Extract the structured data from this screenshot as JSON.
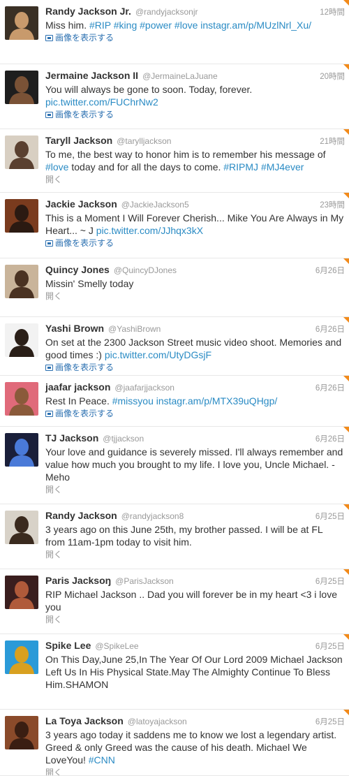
{
  "colors": {
    "link": "#2a8bc4",
    "corner": "#f28a1a",
    "muted": "#999999"
  },
  "tweets": [
    {
      "name": "Randy Jackson Jr.",
      "handle": "@randyjacksonjr",
      "time": "12時間",
      "action": "画像を表示する",
      "action_type": "media",
      "segments": [
        {
          "t": "Miss him. ",
          "link": false
        },
        {
          "t": "#RIP #king #power #love instagr.am/p/MUzlNrl_Xu/",
          "link": true
        }
      ],
      "avatar": {
        "bg": "#3a3025",
        "fg": "#c89a6c"
      }
    },
    {
      "name": "Jermaine Jackson II",
      "handle": "@JermaineLaJuane",
      "time": "20時間",
      "action": "画像を表示する",
      "action_type": "media",
      "segments": [
        {
          "t": "You will always be gone to soon. Today, forever. ",
          "link": false
        },
        {
          "t": "pic.twitter.com/FUChrNw2",
          "link": true
        }
      ],
      "avatar": {
        "bg": "#1e1e1e",
        "fg": "#7a5236"
      }
    },
    {
      "name": "Taryll Jackson",
      "handle": "@tarylljackson",
      "time": "21時間",
      "action": "開く",
      "action_type": "open",
      "segments": [
        {
          "t": "To me, the best way to honor him is to remember his message of ",
          "link": false
        },
        {
          "t": "#love",
          "link": true
        },
        {
          "t": " today and for all the days to come. ",
          "link": false
        },
        {
          "t": "#RIPMJ #MJ4ever",
          "link": true
        }
      ],
      "avatar": {
        "bg": "#d8cfc2",
        "fg": "#5a4030"
      }
    },
    {
      "name": "Jackie Jackson",
      "handle": "@JackieJackson5",
      "time": "23時間",
      "action": "画像を表示する",
      "action_type": "media",
      "segments": [
        {
          "t": "This is a Moment I Will Forever Cherish... Mike You Are Always in My Heart... ~ J ",
          "link": false
        },
        {
          "t": "pic.twitter.com/JJhqx3kX",
          "link": true
        }
      ],
      "avatar": {
        "bg": "#7a3b1e",
        "fg": "#2b1a12"
      }
    },
    {
      "name": "Quincy Jones",
      "handle": "@QuincyDJones",
      "time": "6月26日",
      "action": "開く",
      "action_type": "open",
      "segments": [
        {
          "t": "Missin' Smelly today",
          "link": false
        }
      ],
      "avatar": {
        "bg": "#c9b49a",
        "fg": "#4a3222"
      }
    },
    {
      "name": "Yashi Brown",
      "handle": "@YashiBrown",
      "time": "6月26日",
      "action": "画像を表示する",
      "action_type": "media",
      "segments": [
        {
          "t": "On set at the 2300 Jackson Street music video shoot. Memories and good times :) ",
          "link": false
        },
        {
          "t": "pic.twitter.com/UtyDGsjF",
          "link": true
        }
      ],
      "avatar": {
        "bg": "#f2f2f2",
        "fg": "#2a1f18"
      }
    },
    {
      "name": "jaafar jackson",
      "handle": "@jaafarjjackson",
      "time": "6月26日",
      "action": "画像を表示する",
      "action_type": "media",
      "segments": [
        {
          "t": "Rest In Peace. ",
          "link": false
        },
        {
          "t": "#missyou instagr.am/p/MTX39uQHgp/",
          "link": true
        }
      ],
      "avatar": {
        "bg": "#e06a7a",
        "fg": "#8a5a3a"
      }
    },
    {
      "name": "TJ Jackson",
      "handle": "@tjjackson",
      "time": "6月26日",
      "action": "開く",
      "action_type": "open",
      "segments": [
        {
          "t": "Your love and guidance is severely missed. I'll always remember and value how much you brought to my life. I love you, Uncle Michael. - Meho",
          "link": false
        }
      ],
      "avatar": {
        "bg": "#1a1f3a",
        "fg": "#4a7ad8"
      }
    },
    {
      "name": "Randy Jackson",
      "handle": "@randyjackson8",
      "time": "6月25日",
      "action": "開く",
      "action_type": "open",
      "segments": [
        {
          "t": "3 years ago on this June 25th, my brother passed. I will be at FL from 11am-1pm today to visit him.",
          "link": false
        }
      ],
      "avatar": {
        "bg": "#d8d2c8",
        "fg": "#3a2a1e"
      }
    },
    {
      "name": "Paris Jacksoŋ",
      "handle": "@ParisJackson",
      "time": "6月25日",
      "action": "開く",
      "action_type": "open",
      "segments": [
        {
          "t": "RIP Michael Jackson .. Dad you will forever be in my heart <3 i love you",
          "link": false
        }
      ],
      "avatar": {
        "bg": "#3a1e1e",
        "fg": "#b05a3a"
      }
    },
    {
      "name": "Spike Lee",
      "handle": "@SpikeLee",
      "time": "6月25日",
      "action": "",
      "action_type": "none",
      "segments": [
        {
          "t": "On This Day,June 25,In The Year Of Our Lord 2009 Michael Jackson Left Us In His Physical State.May The Almighty Continue To Bless Him.SHAMON",
          "link": false
        }
      ],
      "avatar": {
        "bg": "#2a9ad8",
        "fg": "#d8a020"
      }
    },
    {
      "name": "La Toya Jackson",
      "handle": "@latoyajackson",
      "time": "6月25日",
      "action": "開く",
      "action_type": "open",
      "segments": [
        {
          "t": "3 years ago today it saddens me to know we lost a legendary artist. Greed & only Greed was the cause of his death. Michael We LoveYou! ",
          "link": false
        },
        {
          "t": "#CNN",
          "link": true
        }
      ],
      "avatar": {
        "bg": "#8a4a2a",
        "fg": "#3a1e12"
      }
    }
  ]
}
